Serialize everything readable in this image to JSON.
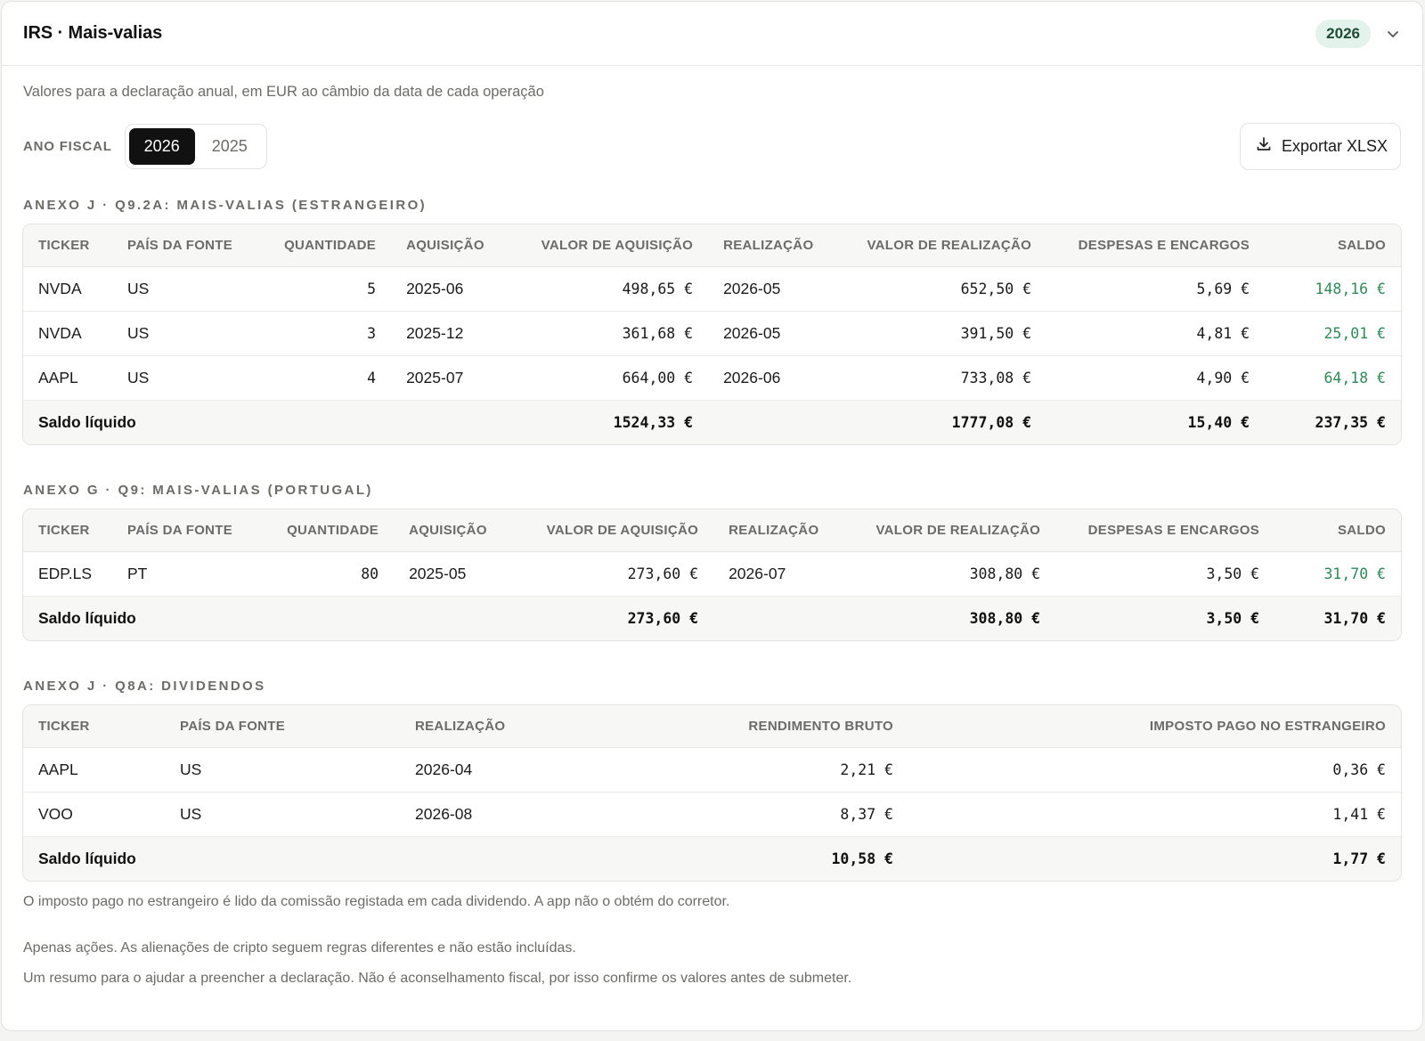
{
  "header": {
    "title": "IRS · Mais-valias",
    "year_badge": "2026"
  },
  "subtitle": "Valores para a declaração anual, em EUR ao câmbio da data de cada operação",
  "toolbar": {
    "fiscal_label": "ANO FISCAL",
    "years": [
      "2026",
      "2025"
    ],
    "selected_year": "2026",
    "export_label": "Exportar XLSX"
  },
  "colors": {
    "accent_dark": "#111111",
    "badge_bg": "#e3f2ea",
    "positive": "#2e8b57"
  },
  "anexo_j_mv": {
    "title": "ANEXO J · Q9.2A: MAIS-VALIAS (ESTRANGEIRO)",
    "columns": [
      "TICKER",
      "PAÍS DA FONTE",
      "QUANTIDADE",
      "AQUISIÇÃO",
      "VALOR DE AQUISIÇÃO",
      "REALIZAÇÃO",
      "VALOR DE REALIZAÇÃO",
      "DESPESAS E ENCARGOS",
      "SALDO"
    ],
    "rows": [
      {
        "ticker": "NVDA",
        "country": "US",
        "qty": "5",
        "acq": "2025-06",
        "acq_value": "498,65 €",
        "real": "2026-05",
        "real_value": "652,50 €",
        "expenses": "5,69 €",
        "saldo": "148,16 €"
      },
      {
        "ticker": "NVDA",
        "country": "US",
        "qty": "3",
        "acq": "2025-12",
        "acq_value": "361,68 €",
        "real": "2026-05",
        "real_value": "391,50 €",
        "expenses": "4,81 €",
        "saldo": "25,01 €"
      },
      {
        "ticker": "AAPL",
        "country": "US",
        "qty": "4",
        "acq": "2025-07",
        "acq_value": "664,00 €",
        "real": "2026-06",
        "real_value": "733,08 €",
        "expenses": "4,90 €",
        "saldo": "64,18 €"
      }
    ],
    "total": {
      "label": "Saldo líquido",
      "acq_value": "1524,33 €",
      "real_value": "1777,08 €",
      "expenses": "15,40 €",
      "saldo": "237,35 €"
    }
  },
  "anexo_g_mv": {
    "title": "ANEXO G · Q9: MAIS-VALIAS (PORTUGAL)",
    "columns": [
      "TICKER",
      "PAÍS DA FONTE",
      "QUANTIDADE",
      "AQUISIÇÃO",
      "VALOR DE AQUISIÇÃO",
      "REALIZAÇÃO",
      "VALOR DE REALIZAÇÃO",
      "DESPESAS E ENCARGOS",
      "SALDO"
    ],
    "rows": [
      {
        "ticker": "EDP.LS",
        "country": "PT",
        "qty": "80",
        "acq": "2025-05",
        "acq_value": "273,60 €",
        "real": "2026-07",
        "real_value": "308,80 €",
        "expenses": "3,50 €",
        "saldo": "31,70 €"
      }
    ],
    "total": {
      "label": "Saldo líquido",
      "acq_value": "273,60 €",
      "real_value": "308,80 €",
      "expenses": "3,50 €",
      "saldo": "31,70 €"
    }
  },
  "anexo_j_div": {
    "title": "ANEXO J · Q8A: DIVIDENDOS",
    "columns": [
      "TICKER",
      "PAÍS DA FONTE",
      "REALIZAÇÃO",
      "RENDIMENTO BRUTO",
      "IMPOSTO PAGO NO ESTRANGEIRO"
    ],
    "rows": [
      {
        "ticker": "AAPL",
        "country": "US",
        "real": "2026-04",
        "gross": "2,21 €",
        "tax": "0,36 €"
      },
      {
        "ticker": "VOO",
        "country": "US",
        "real": "2026-08",
        "gross": "8,37 €",
        "tax": "1,41 €"
      }
    ],
    "total": {
      "label": "Saldo líquido",
      "gross": "10,58 €",
      "tax": "1,77 €"
    }
  },
  "notes": {
    "dividend_note": "O imposto pago no estrangeiro é lido da comissão registada em cada dividendo. A app não o obtém do corretor.",
    "crypto_note": "Apenas ações. As alienações de cripto seguem regras diferentes e não estão incluídas.",
    "disclaimer": "Um resumo para o ajudar a preencher a declaração. Não é aconselhamento fiscal, por isso confirme os valores antes de submeter."
  }
}
